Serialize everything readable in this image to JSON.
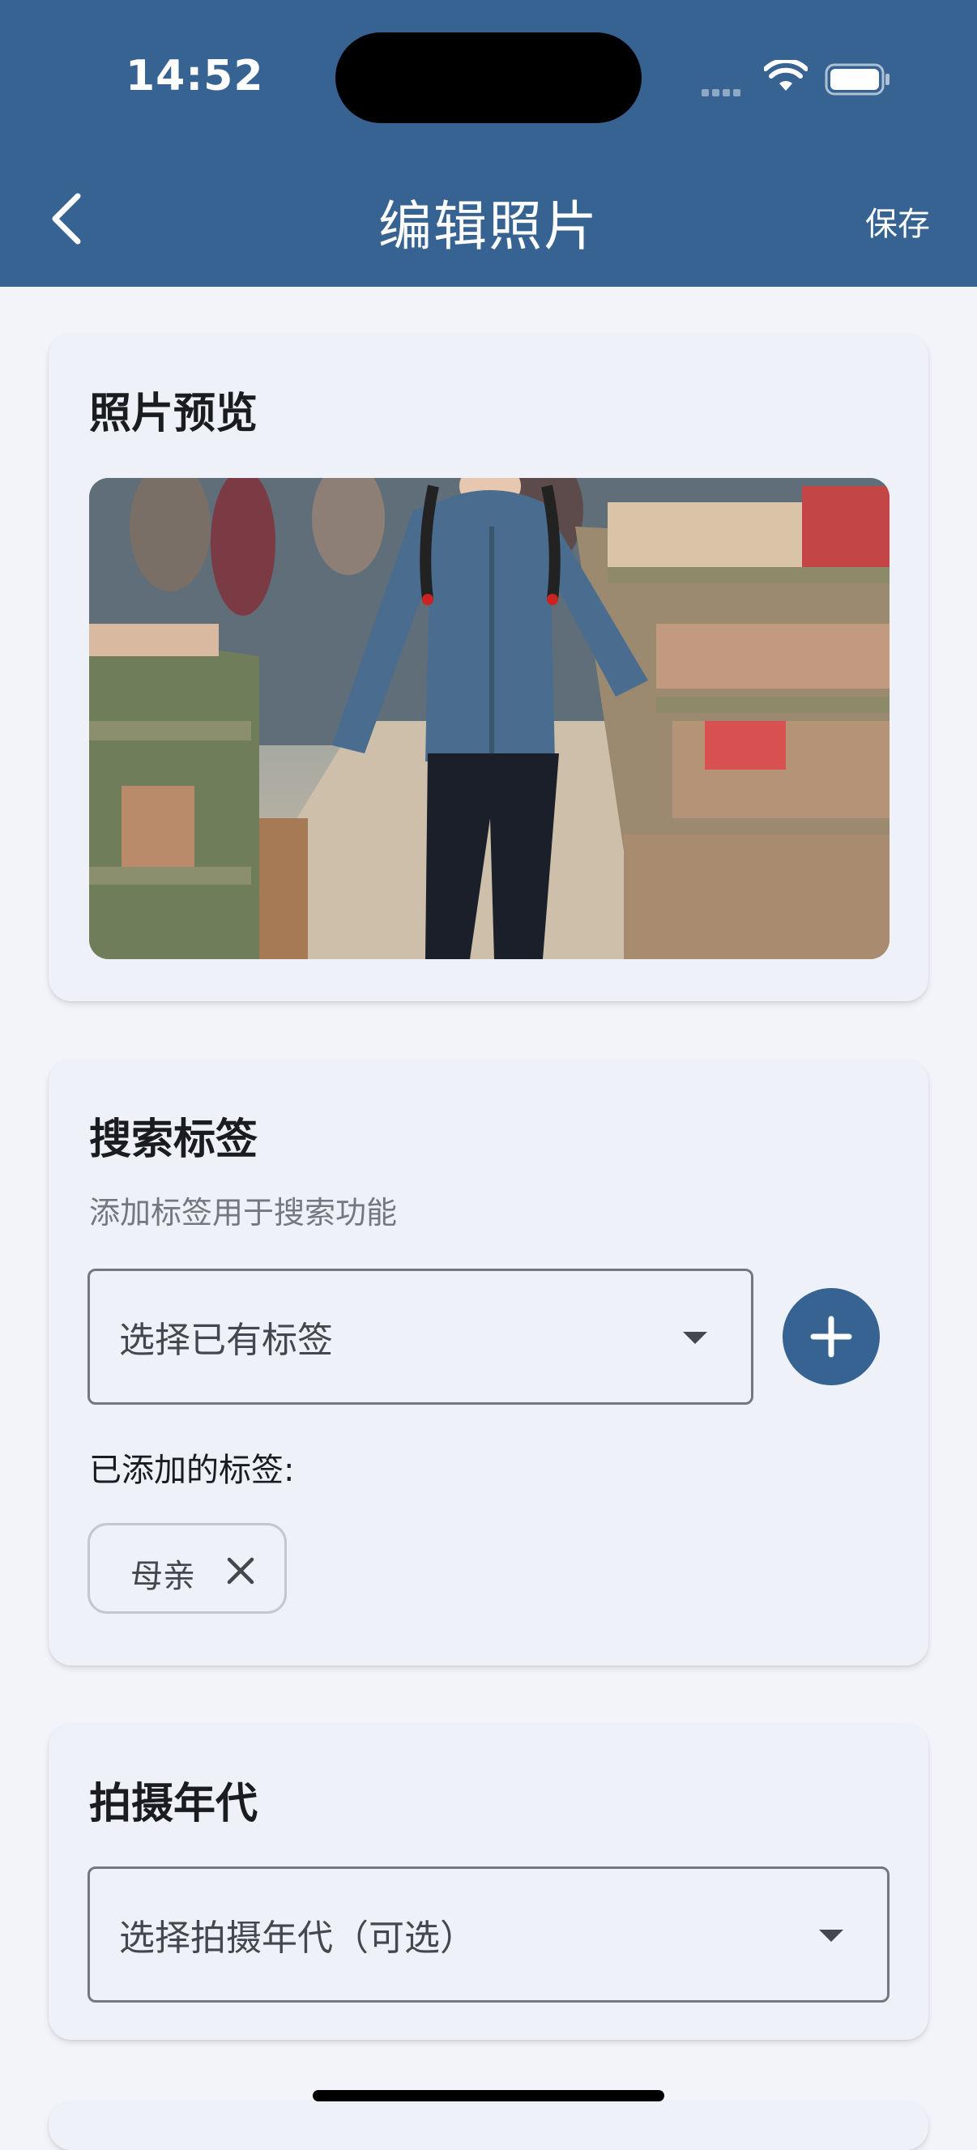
{
  "status_bar": {
    "time": "14:52"
  },
  "app_bar": {
    "title": "编辑照片",
    "save_label": "保存"
  },
  "preview_card": {
    "title": "照片预览"
  },
  "tags_card": {
    "title": "搜索标签",
    "subtitle": "添加标签用于搜索功能",
    "select_placeholder": "选择已有标签",
    "added_label": "已添加的标签:",
    "tags": [
      {
        "label": "母亲"
      }
    ]
  },
  "era_card": {
    "title": "拍摄年代",
    "select_placeholder": "选择拍摄年代（可选）"
  },
  "colors": {
    "primary": "#366391",
    "background": "#f3f4fa",
    "card": "#eff1f8"
  },
  "icons": [
    "back-arrow-icon",
    "plus-icon",
    "close-icon",
    "dropdown-caret-icon",
    "wifi-icon",
    "battery-icon",
    "signal-icon"
  ]
}
